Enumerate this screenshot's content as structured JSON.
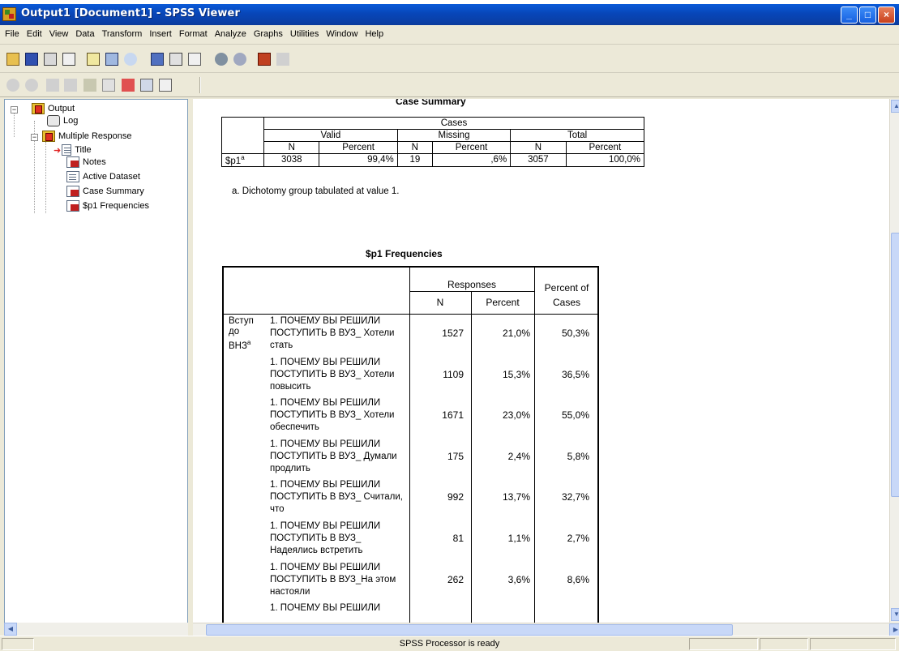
{
  "window": {
    "title": "Output1 [Document1] - SPSS Viewer",
    "min_label": "_",
    "max_label": "□",
    "close_label": "×"
  },
  "menu": [
    "File",
    "Edit",
    "View",
    "Data",
    "Transform",
    "Insert",
    "Format",
    "Analyze",
    "Graphs",
    "Utilities",
    "Window",
    "Help"
  ],
  "tree": {
    "output": "Output",
    "log": "Log",
    "multiple_response": "Multiple Response",
    "title": "Title",
    "notes": "Notes",
    "active_dataset": "Active Dataset",
    "case_summary": "Case Summary",
    "frequencies": "$p1 Frequencies"
  },
  "case_summary": {
    "title": "Case Summary",
    "cases": "Cases",
    "valid": "Valid",
    "missing": "Missing",
    "total": "Total",
    "n": "N",
    "percent": "Percent",
    "row_label": "$p1",
    "row_sup": "a",
    "values": [
      "3038",
      "99,4%",
      "19",
      ",6%",
      "3057",
      "100,0%"
    ],
    "footnote": "a. Dichotomy group tabulated at value 1."
  },
  "frequencies": {
    "title": "$p1 Frequencies",
    "responses": "Responses",
    "n": "N",
    "percent": "Percent",
    "percent_of_cases": "Percent of Cases",
    "group_label": "Вступ до ВНЗ",
    "group_sup": "a",
    "rows": [
      {
        "label": "1. ПОЧЕМУ ВЫ РЕШИЛИ ПОСТУПИТЬ В ВУЗ_ Хотели стать",
        "n": "1527",
        "pct": "21,0%",
        "cases": "50,3%"
      },
      {
        "label": "1. ПОЧЕМУ ВЫ РЕШИЛИ ПОСТУПИТЬ В ВУЗ_ Хотели повысить",
        "n": "1109",
        "pct": "15,3%",
        "cases": "36,5%"
      },
      {
        "label": "1. ПОЧЕМУ ВЫ РЕШИЛИ ПОСТУПИТЬ В ВУЗ_ Хотели обеспечить",
        "n": "1671",
        "pct": "23,0%",
        "cases": "55,0%"
      },
      {
        "label": "1. ПОЧЕМУ ВЫ РЕШИЛИ ПОСТУПИТЬ В ВУЗ_ Думали продлить",
        "n": "175",
        "pct": "2,4%",
        "cases": "5,8%"
      },
      {
        "label": "1. ПОЧЕМУ ВЫ РЕШИЛИ ПОСТУПИТЬ В ВУЗ_ Считали, что",
        "n": "992",
        "pct": "13,7%",
        "cases": "32,7%"
      },
      {
        "label": "1. ПОЧЕМУ ВЫ РЕШИЛИ ПОСТУПИТЬ В ВУЗ_ Надеялись встретить",
        "n": "81",
        "pct": "1,1%",
        "cases": "2,7%"
      },
      {
        "label": "1. ПОЧЕМУ ВЫ РЕШИЛИ ПОСТУПИТЬ В ВУЗ_На этом настояли",
        "n": "262",
        "pct": "3,6%",
        "cases": "8,6%"
      },
      {
        "label": "1. ПОЧЕМУ ВЫ РЕШИЛИ",
        "n": "",
        "pct": "",
        "cases": ""
      }
    ]
  },
  "status": {
    "text": "SPSS Processor is ready"
  }
}
